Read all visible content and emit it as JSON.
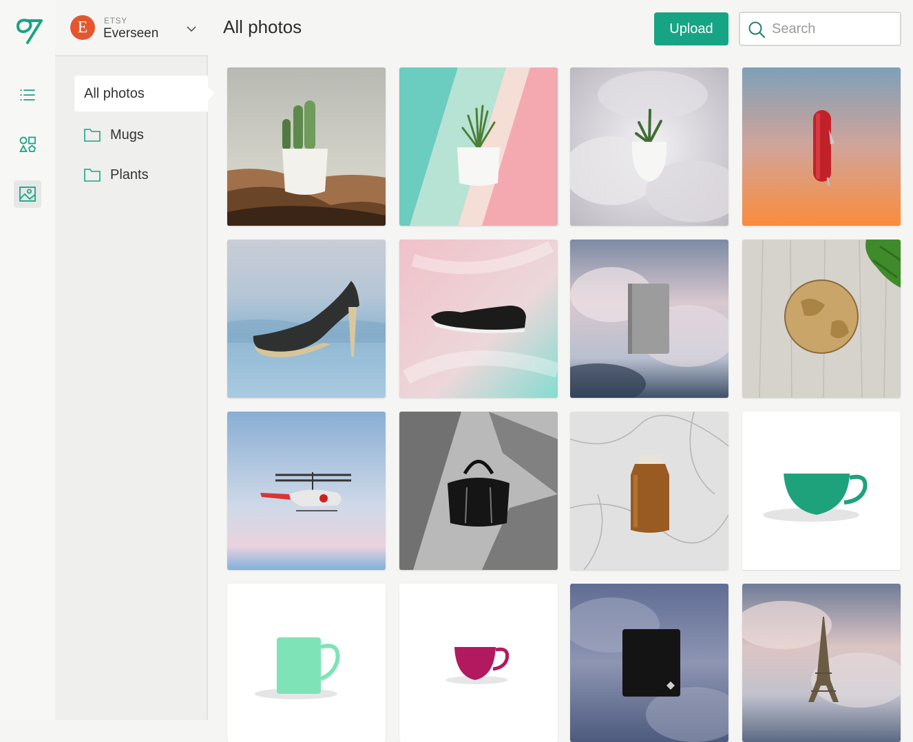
{
  "rail": {
    "items": [
      {
        "icon": "list-icon",
        "active": false
      },
      {
        "icon": "shapes-icon",
        "active": false
      },
      {
        "icon": "image-icon",
        "active": true
      }
    ]
  },
  "shop": {
    "avatar_letter": "E",
    "platform": "ETSY",
    "name": "Everseen"
  },
  "sidebar": {
    "items": [
      {
        "label": "All photos",
        "active": true
      },
      {
        "label": "Mugs",
        "icon": "folder-icon"
      },
      {
        "label": "Plants",
        "icon": "folder-icon"
      }
    ]
  },
  "header": {
    "title": "All photos",
    "upload_label": "Upload",
    "search_placeholder": "Search"
  },
  "colors": {
    "accent": "#17a484",
    "shop_avatar": "#e4572e"
  },
  "photos": [
    {
      "subject": "cactus-in-desert"
    },
    {
      "subject": "plant-on-stripes"
    },
    {
      "subject": "plant-in-feathers"
    },
    {
      "subject": "red-pocket-knife"
    },
    {
      "subject": "black-high-heel"
    },
    {
      "subject": "black-loafer"
    },
    {
      "subject": "grey-notebook-clouds"
    },
    {
      "subject": "globe-on-wood"
    },
    {
      "subject": "toy-helicopter"
    },
    {
      "subject": "black-handbag-shadows"
    },
    {
      "subject": "amber-bottle-marble"
    },
    {
      "subject": "green-cup"
    },
    {
      "subject": "mint-mug"
    },
    {
      "subject": "magenta-cup"
    },
    {
      "subject": "black-wallet"
    },
    {
      "subject": "eiffel-tower-clouds"
    }
  ]
}
